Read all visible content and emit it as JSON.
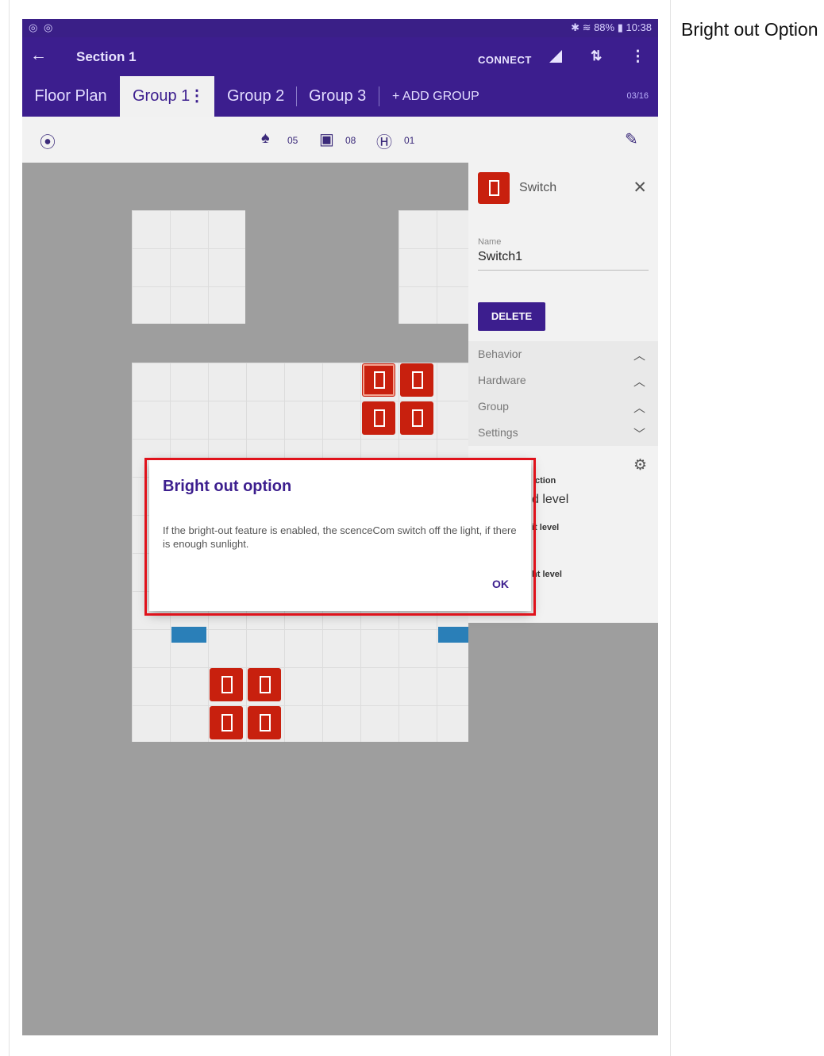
{
  "caption": "Bright out Option",
  "status_bar": {
    "left_icons": "◎ ◎",
    "right": "✱ ≋ 88% ▮ 10:38"
  },
  "app_bar": {
    "back_icon": "←",
    "title": "Section 1",
    "connect": "CONNECT",
    "sort_icon": "⇅",
    "more_icon": "⋮"
  },
  "tabs": {
    "floor_plan": "Floor Plan",
    "group1": "Group 1",
    "group1_menu": "⋮",
    "group2": "Group 2",
    "group3": "Group 3",
    "add_group": "+ ADD GROUP",
    "count": "03/16"
  },
  "toolbar": {
    "locate_icon": "⦿",
    "light_icon": "♠",
    "light_count": "05",
    "switch_icon": "▣",
    "switch_count": "08",
    "sensor_icon": "Ⓗ",
    "sensor_count": "01",
    "wand_icon": "✎"
  },
  "panel": {
    "device_type": "Switch",
    "close_icon": "✕",
    "name_label": "Name",
    "name_value": "Switch1",
    "delete": "DELETE",
    "sections": [
      {
        "label": "Behavior",
        "chevron": "︿"
      },
      {
        "label": "Hardware",
        "chevron": "︿"
      },
      {
        "label": "Group",
        "chevron": "︿"
      },
      {
        "label": "Settings",
        "chevron": "﹀"
      }
    ],
    "gear_icon": "⚙",
    "partial_texts": [
      "ction",
      "d level",
      "it level",
      "ht level"
    ]
  },
  "dialog": {
    "title": "Bright out option",
    "body": "If the bright-out feature is enabled, the scenceCom switch off the light, if there is enough sunlight.",
    "ok": "OK"
  }
}
